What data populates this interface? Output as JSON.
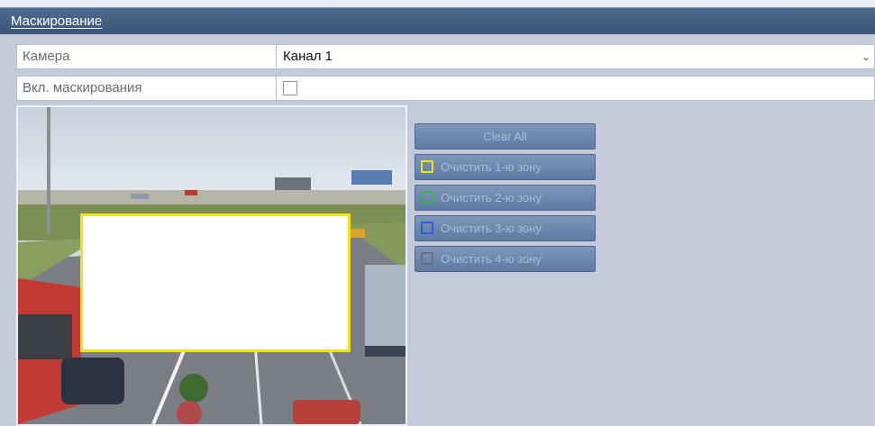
{
  "tab": {
    "title": "Маскирование"
  },
  "camera": {
    "label": "Камера",
    "value": "Канал 1"
  },
  "mask_enable": {
    "label": "Вкл. маскирования",
    "checked": false
  },
  "buttons": {
    "clear_all": "Clear All",
    "zones": [
      {
        "label": "Очистить 1-ю зону",
        "color": "#f2e21a"
      },
      {
        "label": "Очистить 2-ю зону",
        "color": "#3fae4a"
      },
      {
        "label": "Очистить 3-ю зону",
        "color": "#2f5fe0"
      },
      {
        "label": "Очистить 4-ю зону",
        "color": "#6a6f78"
      }
    ]
  },
  "icons": {
    "dropdown": "chevron-down-icon"
  }
}
